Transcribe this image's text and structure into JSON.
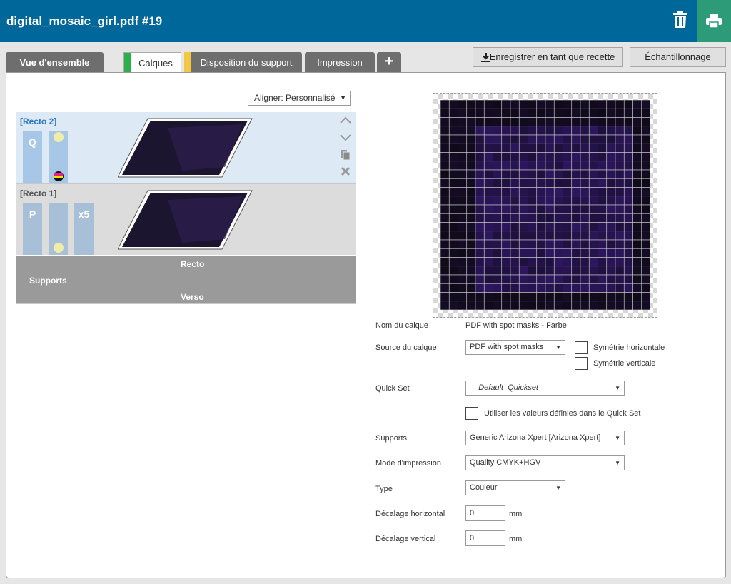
{
  "header": {
    "title": "digital_mosaic_girl.pdf #19",
    "delete_icon": "trash-icon",
    "print_icon": "printer-icon"
  },
  "tabs": [
    {
      "label": "Vue d'ensemble"
    },
    {
      "label": "Calques",
      "marker_color": "#2eaf4a"
    },
    {
      "label": "Disposition du support",
      "marker_color": "#f2c744"
    },
    {
      "label": "Impression"
    },
    {
      "label": "+"
    }
  ],
  "toolbar": {
    "save_recipe": "Enregistrer en tant que recette",
    "sampling": "Échantillonnage"
  },
  "align": {
    "value": "Aligner: Personnalisé"
  },
  "layers": [
    {
      "name": "[Recto 2]",
      "box1": "Q",
      "box2": "",
      "box3": ""
    },
    {
      "name": "[Recto 1]",
      "box1": "P",
      "box2": "",
      "box3": "x5"
    }
  ],
  "supports": {
    "recto": "Recto",
    "label": "Supports",
    "verso": "Verso"
  },
  "form": {
    "layer_name_label": "Nom du calque",
    "layer_name_value": "PDF with spot masks - Farbe",
    "layer_source_label": "Source du calque",
    "layer_source_value": "PDF with spot masks",
    "flip_h": "Symétrie horizontale",
    "flip_v": "Symétrie verticale",
    "quickset_label": "Quick Set",
    "quickset_value": "__Default_Quickset__",
    "use_quickset": "Utiliser les valeurs définies dans le Quick Set",
    "media_label": "Supports",
    "media_value": "Generic Arizona Xpert [Arizona Xpert]",
    "print_mode_label": "Mode d'impression",
    "print_mode_value": "Quality CMYK+HGV",
    "type_label": "Type",
    "type_value": "Couleur",
    "offset_h_label": "Décalage horizontal",
    "offset_h_value": "0",
    "offset_v_label": "Décalage vertical",
    "offset_v_value": "0",
    "unit": "mm"
  },
  "colors": {
    "header": "#00679b",
    "print_button": "#2e9b78",
    "active_layer": "#dde9f4",
    "supports_bar": "#9a9a9a"
  }
}
